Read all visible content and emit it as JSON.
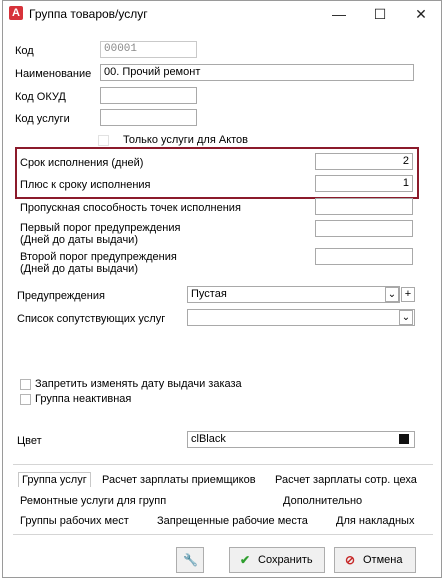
{
  "window": {
    "title": "Группа товаров/услуг",
    "app_icon_letter": "A",
    "minimize": "—",
    "maximize": "☐",
    "close": "✕"
  },
  "form": {
    "code_label": "Код",
    "code_value": "00001",
    "name_label": "Наименование",
    "name_value": "00. Прочий ремонт",
    "okud_label": "Код ОКУД",
    "okud_value": "",
    "service_code_label": "Код услуги",
    "service_code_value": "",
    "only_acts_label": "Только услуги для Актов",
    "term_label": "Срок исполнения (дней)",
    "term_value": "2",
    "plus_term_label": "Плюс к сроку исполнения",
    "plus_term_value": "1",
    "throughput_label": "Пропускная способность точек исполнения",
    "first_threshold_label_1": "Первый порог предупреждения",
    "first_threshold_label_2": "(Дней до даты выдачи)",
    "second_threshold_label_1": "Второй порог предупреждения",
    "second_threshold_label_2": "(Дней до даты выдачи)",
    "warnings_label": "Предупреждения",
    "warnings_value": "Пустая",
    "related_services_label": "Список сопутствующих услуг",
    "related_services_value": "",
    "forbid_date_change_label": "Запретить изменять дату выдачи заказа",
    "inactive_label": "Группа неактивная",
    "color_label": "Цвет",
    "color_value": "clBlack"
  },
  "tabs": {
    "row1": [
      "Группа услуг",
      "Расчет зарплаты приемщиков",
      "Расчет зарплаты сотр. цеха"
    ],
    "row2": [
      "Ремонтные услуги для групп",
      "Дополнительно"
    ],
    "row3": [
      "Группы рабочих мест",
      "Запрещенные рабочие места",
      "Для накладных"
    ]
  },
  "buttons": {
    "save": "Сохранить",
    "cancel": "Отмена"
  },
  "colors": {
    "highlight_border": "#8b1a2b",
    "save_icon": "#2e9e2e",
    "cancel_icon": "#c62828"
  }
}
